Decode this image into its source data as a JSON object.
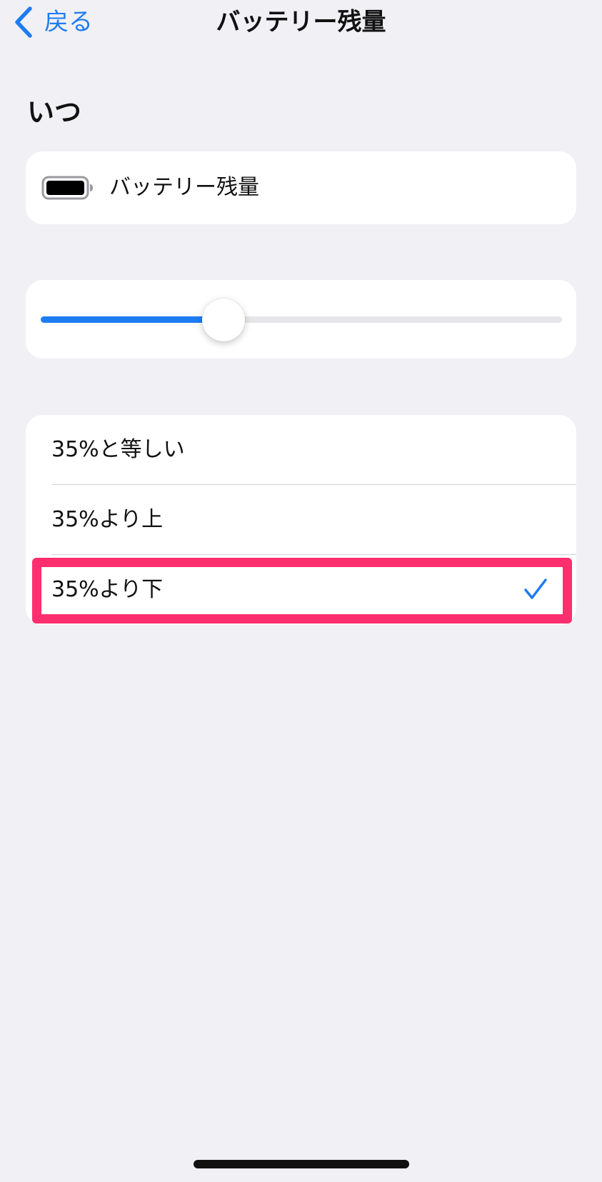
{
  "nav": {
    "back_label": "戻る",
    "title": "バッテリー残量"
  },
  "section": {
    "title": "いつ"
  },
  "trigger": {
    "label": "バッテリー残量",
    "icon": "battery-full-icon"
  },
  "slider": {
    "value_fraction": 0.35,
    "fill_color": "#1e7cf2",
    "track_color": "#e5e5ea"
  },
  "options": [
    {
      "label": "35%と等しい",
      "selected": false
    },
    {
      "label": "35%より上",
      "selected": false
    },
    {
      "label": "35%より下",
      "selected": true
    }
  ],
  "colors": {
    "accent": "#1e7cf2",
    "highlight": "#ff2e6e",
    "background": "#f0f0f5"
  }
}
